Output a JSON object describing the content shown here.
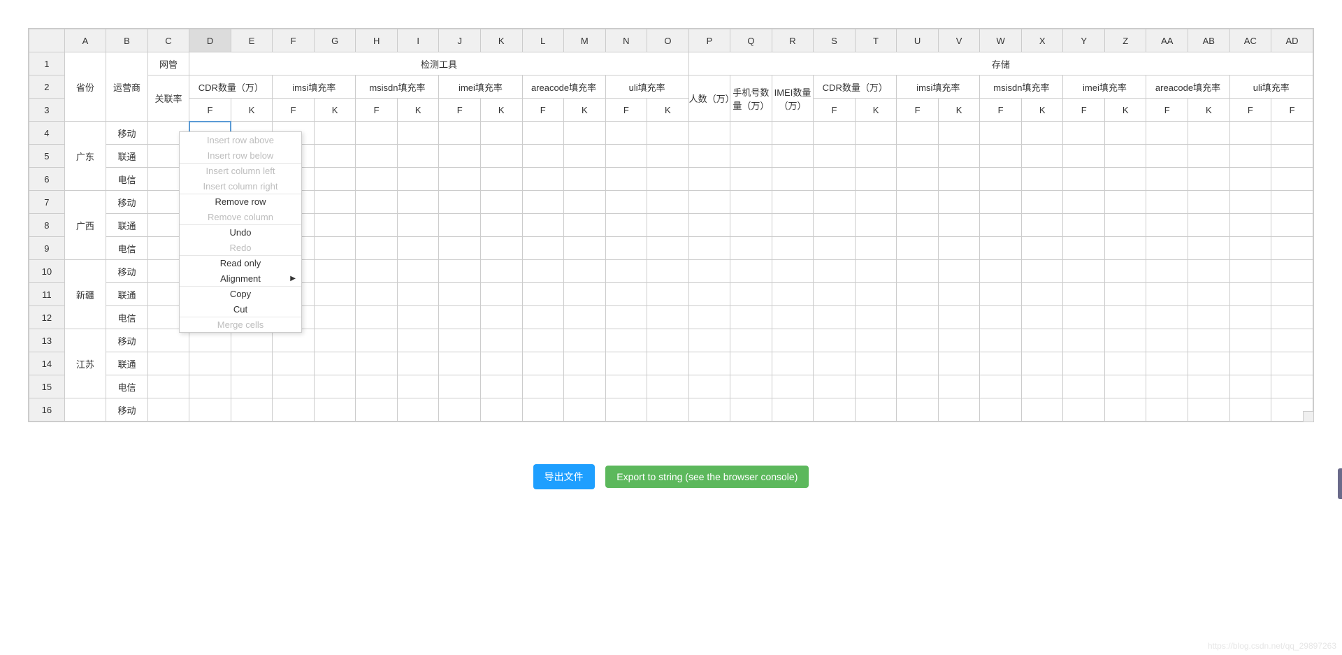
{
  "columns": [
    "A",
    "B",
    "C",
    "D",
    "E",
    "F",
    "G",
    "H",
    "I",
    "J",
    "K",
    "L",
    "M",
    "N",
    "O",
    "P",
    "Q",
    "R",
    "S",
    "T",
    "U",
    "V",
    "W",
    "X",
    "Y",
    "Z",
    "AA",
    "AB",
    "AC",
    "AD"
  ],
  "row_numbers": [
    1,
    2,
    3,
    4,
    5,
    6,
    7,
    8,
    9,
    10,
    11,
    12,
    13,
    14,
    15,
    16
  ],
  "selected_col_index": 3,
  "selected_cell": "D4",
  "header": {
    "r1": {
      "C": "网管",
      "D_O": "检测工具",
      "P_AD": "存储"
    },
    "r2": {
      "A": "省份",
      "B": "运营商",
      "C": "关联率",
      "D_E": "CDR数量（万）",
      "F_G": "imsi填充率",
      "H_I": "msisdn填充率",
      "J_K": "imei填充率",
      "L_M": "areacode填充率",
      "N_O": "uli填充率",
      "P": "人数（万）",
      "Q": "手机号数量（万）",
      "R": "IMEI数量（万）",
      "S_T": "CDR数量（万）",
      "U_V": "imsi填充率",
      "W_X": "msisdn填充率",
      "Y_Z": "imei填充率",
      "AA_AB": "areacode填充率",
      "AC_AD": "uli填充率"
    },
    "r3": {
      "D": "F",
      "E": "K",
      "F": "F",
      "G": "K",
      "H": "F",
      "I": "K",
      "J": "F",
      "K": "K",
      "L": "F",
      "M": "K",
      "N": "F",
      "O": "K",
      "S": "F",
      "T": "K",
      "U": "F",
      "V": "K",
      "W": "F",
      "X": "K",
      "Y": "F",
      "Z": "K",
      "AA": "F",
      "AB": "K",
      "AC": "F",
      "AD": "F"
    }
  },
  "provinces": [
    {
      "name": "广东",
      "carriers": [
        "移动",
        "联通",
        "电信"
      ]
    },
    {
      "name": "广西",
      "carriers": [
        "移动",
        "联通",
        "电信"
      ]
    },
    {
      "name": "新疆",
      "carriers": [
        "移动",
        "联通",
        "电信"
      ]
    },
    {
      "name": "江苏",
      "carriers": [
        "移动",
        "联通",
        "电信"
      ]
    }
  ],
  "extra_rows": [
    {
      "carrier": "移动"
    }
  ],
  "context_menu": {
    "items": [
      {
        "label": "Insert row above",
        "enabled": false
      },
      {
        "label": "Insert row below",
        "enabled": false
      },
      {
        "label": "Insert column left",
        "enabled": false,
        "sep": true
      },
      {
        "label": "Insert column right",
        "enabled": false
      },
      {
        "label": "Remove row",
        "enabled": true,
        "sep": true
      },
      {
        "label": "Remove column",
        "enabled": false
      },
      {
        "label": "Undo",
        "enabled": true,
        "sep": true
      },
      {
        "label": "Redo",
        "enabled": false
      },
      {
        "label": "Read only",
        "enabled": true,
        "sep": true
      },
      {
        "label": "Alignment",
        "enabled": true,
        "submenu": true
      },
      {
        "label": "Copy",
        "enabled": true,
        "sep": true
      },
      {
        "label": "Cut",
        "enabled": true
      },
      {
        "label": "Merge cells",
        "enabled": false,
        "sep": true
      }
    ]
  },
  "buttons": {
    "export_file": "导出文件",
    "export_string": "Export to string (see the browser console)"
  },
  "watermark": "https://blog.csdn.net/qq_29897263"
}
